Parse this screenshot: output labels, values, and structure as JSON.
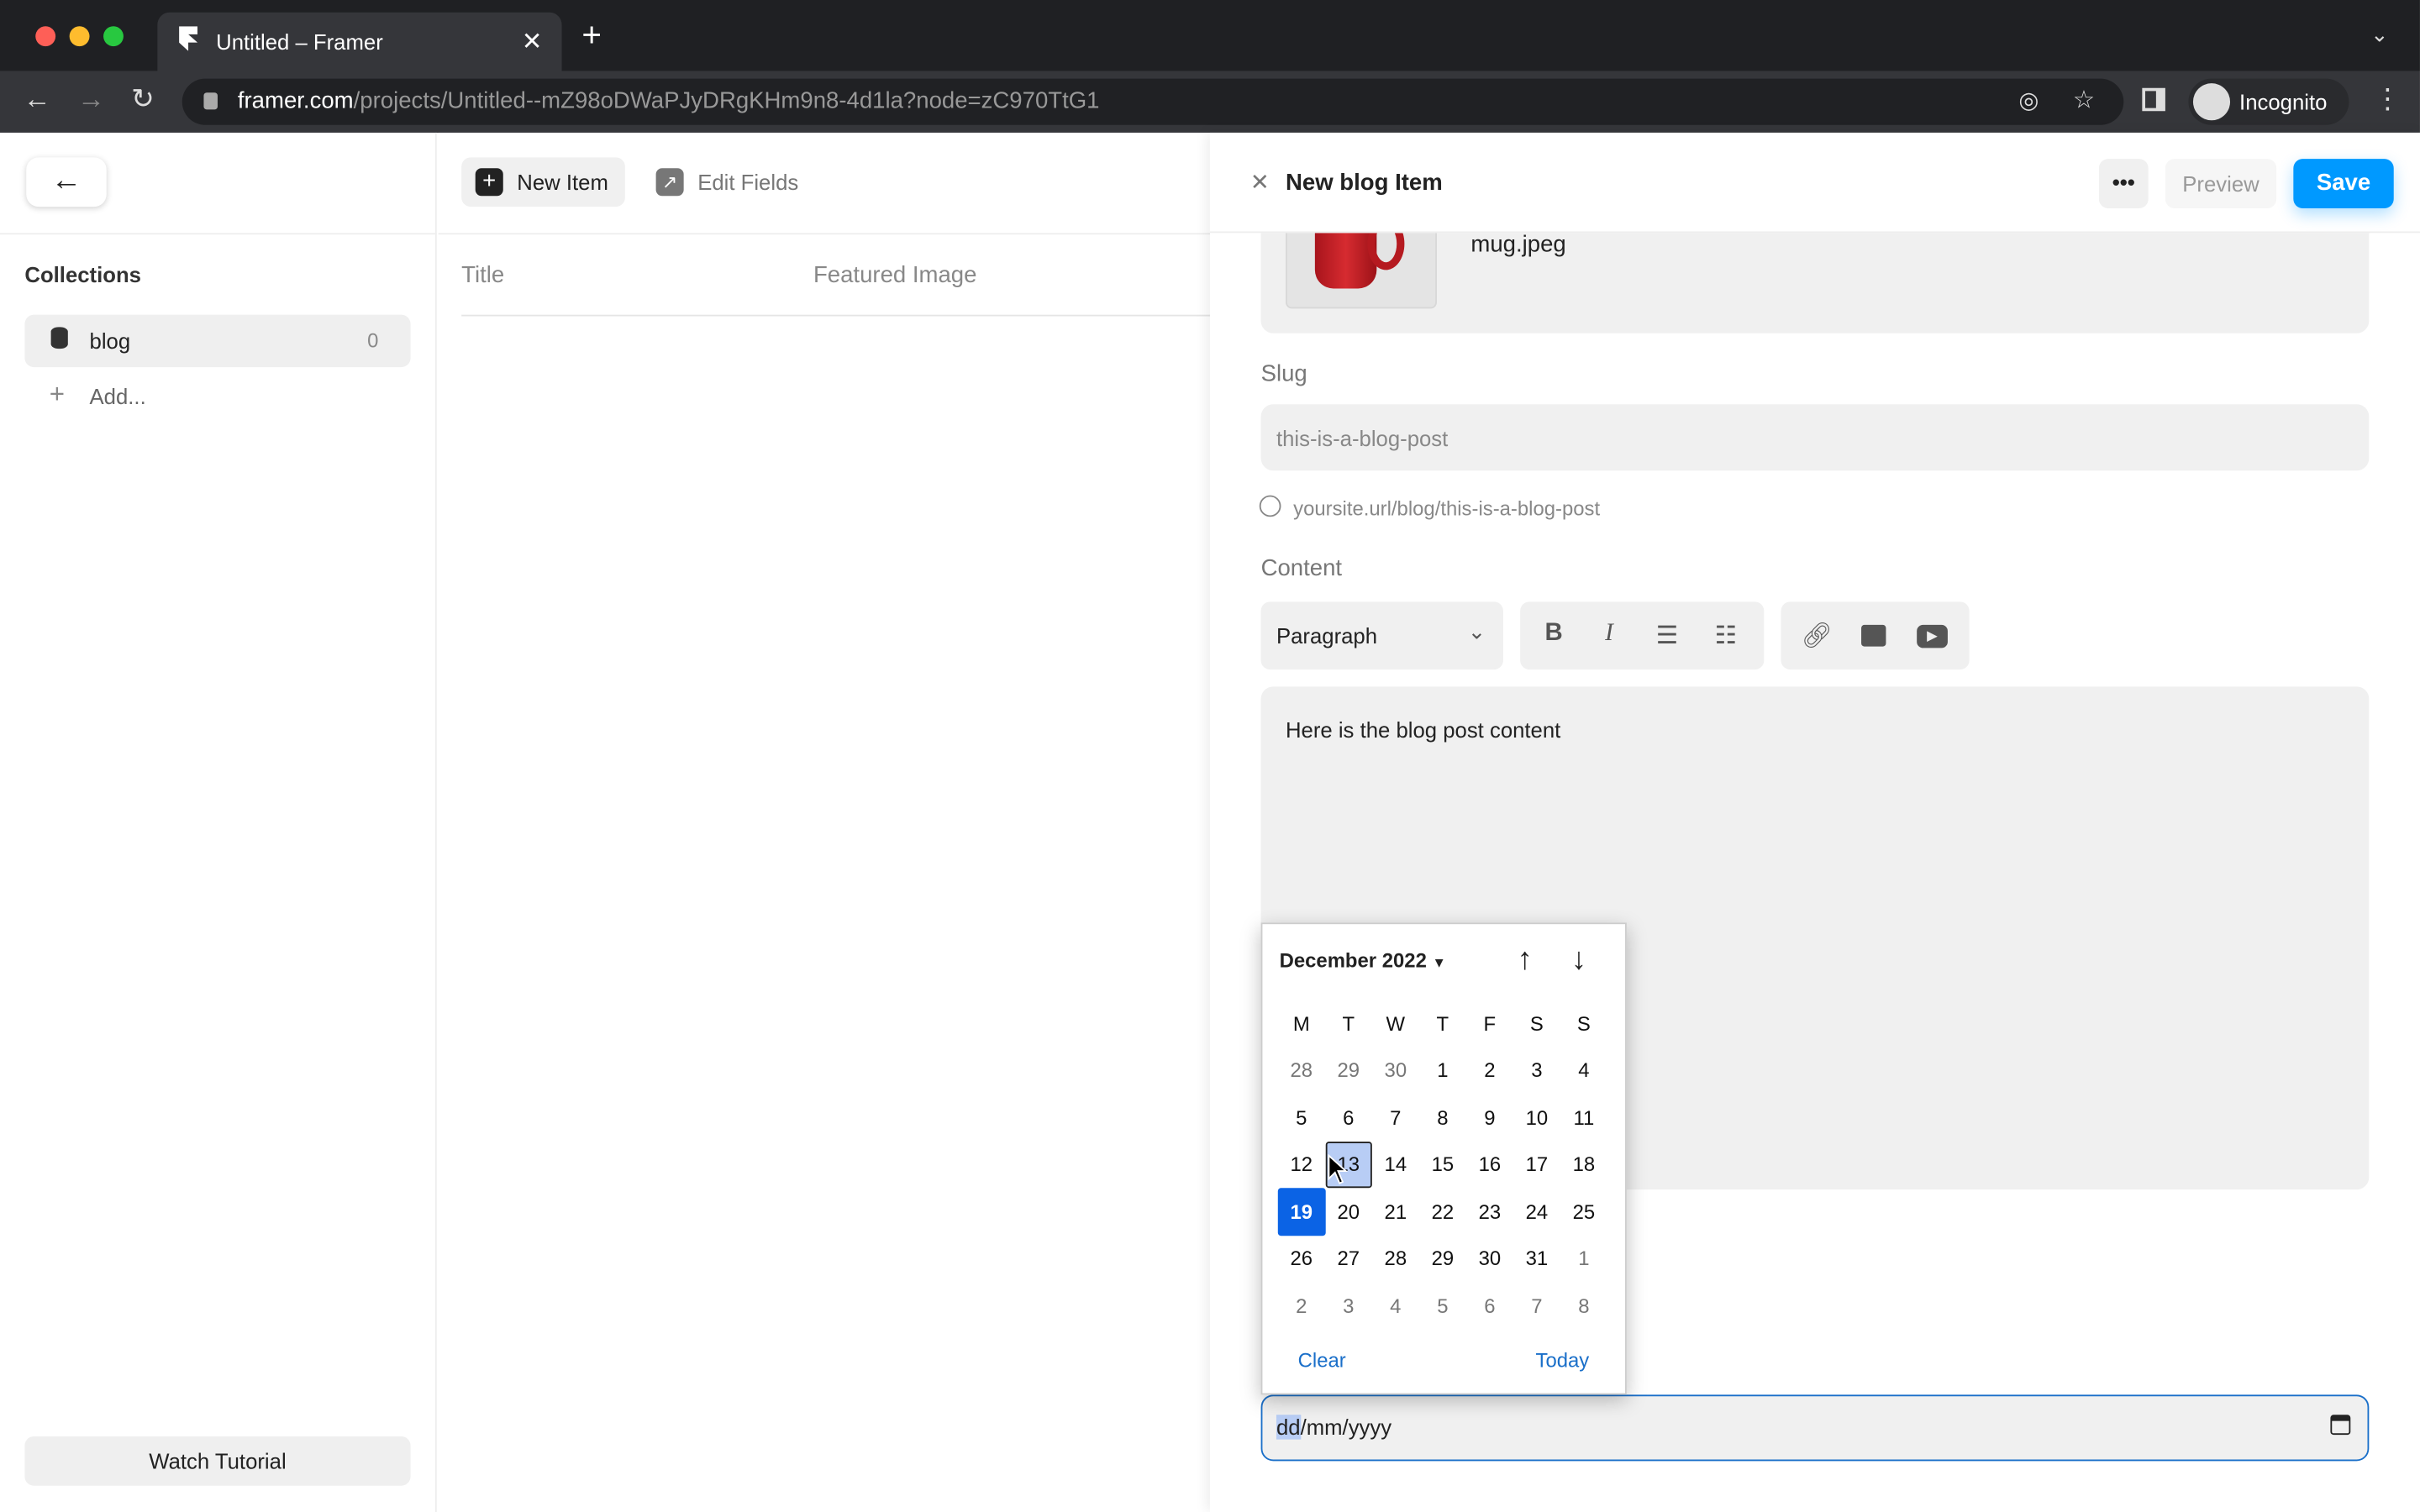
{
  "browser": {
    "tab_title": "Untitled – Framer",
    "url_host": "framer.com",
    "url_path": "/projects/Untitled--mZ98oDWaPJyDRgKHm9n8-4d1la?node=zC970TtG1",
    "profile": "Incognito"
  },
  "sidebar": {
    "heading": "Collections",
    "items": [
      {
        "label": "blog",
        "count": "0"
      }
    ],
    "add_label": "Add...",
    "tutorial_label": "Watch Tutorial"
  },
  "toolbar": {
    "new_item": "New Item",
    "edit_fields": "Edit Fields"
  },
  "table": {
    "columns": [
      "Title",
      "Featured Image"
    ]
  },
  "panel": {
    "title": "New blog Item",
    "preview": "Preview",
    "save": "Save",
    "image_name": "mug.jpeg",
    "slug_label": "Slug",
    "slug_value": "this-is-a-blog-post",
    "url_preview": "yoursite.url/blog/this-is-a-blog-post",
    "content_label": "Content",
    "paragraph_select": "Paragraph",
    "content_text": "Here is the blog post content",
    "date_placeholder": {
      "dd": "dd",
      "rest": "/mm/yyyy"
    }
  },
  "calendar": {
    "month": "December 2022",
    "weekdays": [
      "M",
      "T",
      "W",
      "T",
      "F",
      "S",
      "S"
    ],
    "days": [
      [
        "28",
        "29",
        "30",
        "1",
        "2",
        "3",
        "4"
      ],
      [
        "5",
        "6",
        "7",
        "8",
        "9",
        "10",
        "11"
      ],
      [
        "12",
        "13",
        "14",
        "15",
        "16",
        "17",
        "18"
      ],
      [
        "19",
        "20",
        "21",
        "22",
        "23",
        "24",
        "25"
      ],
      [
        "26",
        "27",
        "28",
        "29",
        "30",
        "31",
        "1"
      ],
      [
        "2",
        "3",
        "4",
        "5",
        "6",
        "7",
        "8"
      ]
    ],
    "selected": "19",
    "hovered": "13",
    "clear": "Clear",
    "today": "Today"
  },
  "colors": {
    "accent": "#0099ff",
    "calendar_selected": "#0b63e5",
    "link": "#1a6fc9"
  }
}
